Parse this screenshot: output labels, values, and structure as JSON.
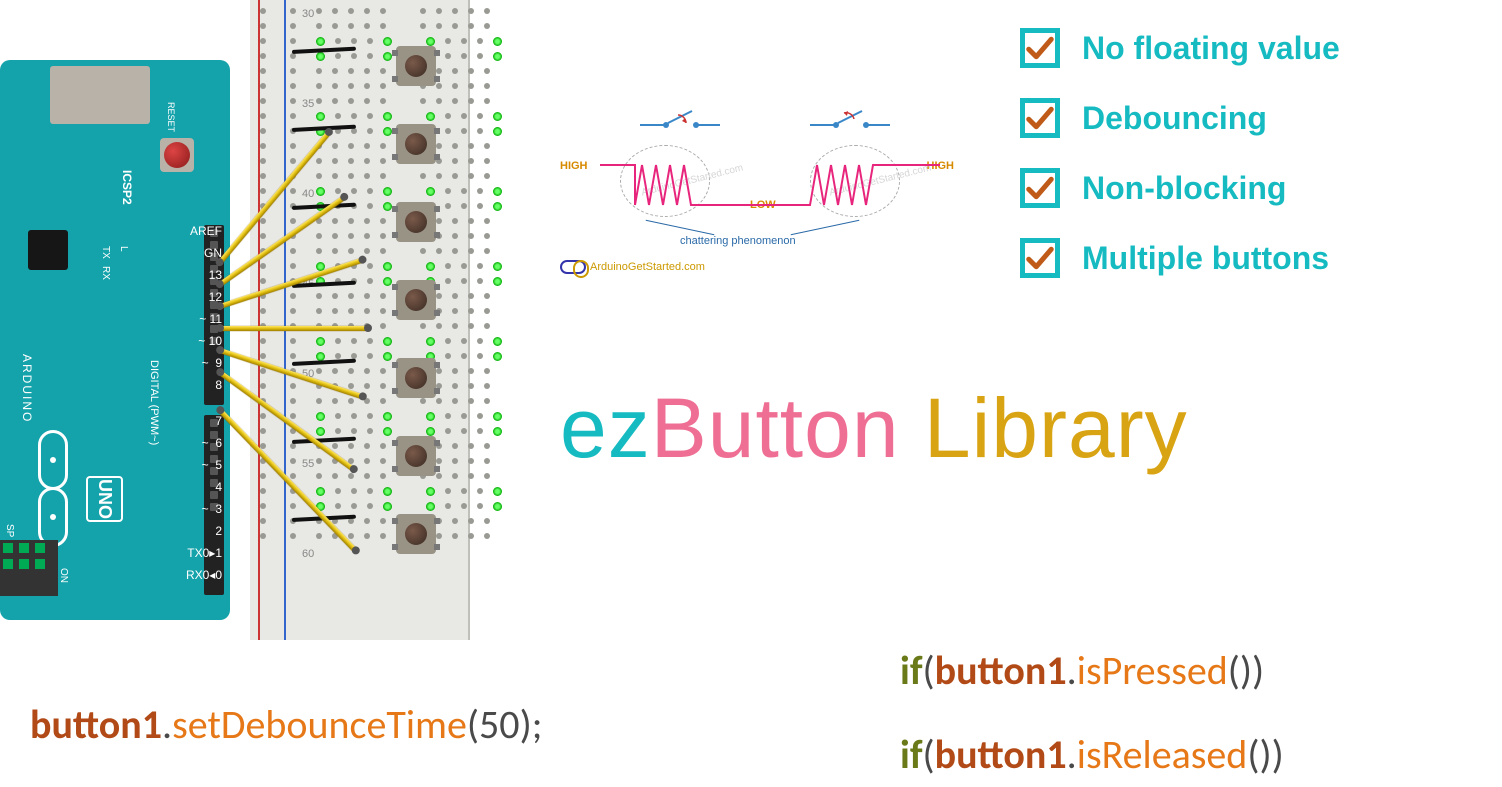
{
  "arduino": {
    "board_name": "ARDUINO",
    "model": "UNO",
    "labels_top": "AREF\nGN\n13\n12\n~ 11\n~ 10\n~  9\n   8",
    "labels_bot": "   7\n~  6\n~  5\n   4\n~  3\n   2\nTX0▸1\nRX0◂0",
    "digital_label": "DIGITAL (PWM~)",
    "icsp_label": "ICSP2",
    "reset_label": "RESET",
    "tx_label": "TX",
    "rx_label": "RX",
    "l_label": "L",
    "on_label": "ON",
    "sp_label": "SP"
  },
  "breadboard": {
    "row_labels": [
      "30",
      "35",
      "40",
      "45",
      "50",
      "55",
      "60"
    ]
  },
  "features": [
    "No floating value",
    "Debouncing",
    "Non-blocking",
    "Multiple buttons"
  ],
  "bounce": {
    "high": "HIGH",
    "low": "LOW",
    "caption": "chattering phenomenon",
    "logo_text": "ArduinoGetStarted.com",
    "watermark": "ArduinoGetStarted.com"
  },
  "title": {
    "p1": "ez",
    "p2": "Button",
    "p3": " Library"
  },
  "code": {
    "a": {
      "obj": "button1",
      "dot": ".",
      "fn": "setDebounceTime",
      "open": "(",
      "arg": "50",
      "close": ");"
    },
    "b": {
      "if": "if",
      "open": "(",
      "obj": "button1",
      "dot": ".",
      "fn": "isPressed",
      "paren": "())"
    },
    "c": {
      "if": "if",
      "open": "(",
      "obj": "button1",
      "dot": ".",
      "fn": "isReleased",
      "paren": "())"
    }
  }
}
